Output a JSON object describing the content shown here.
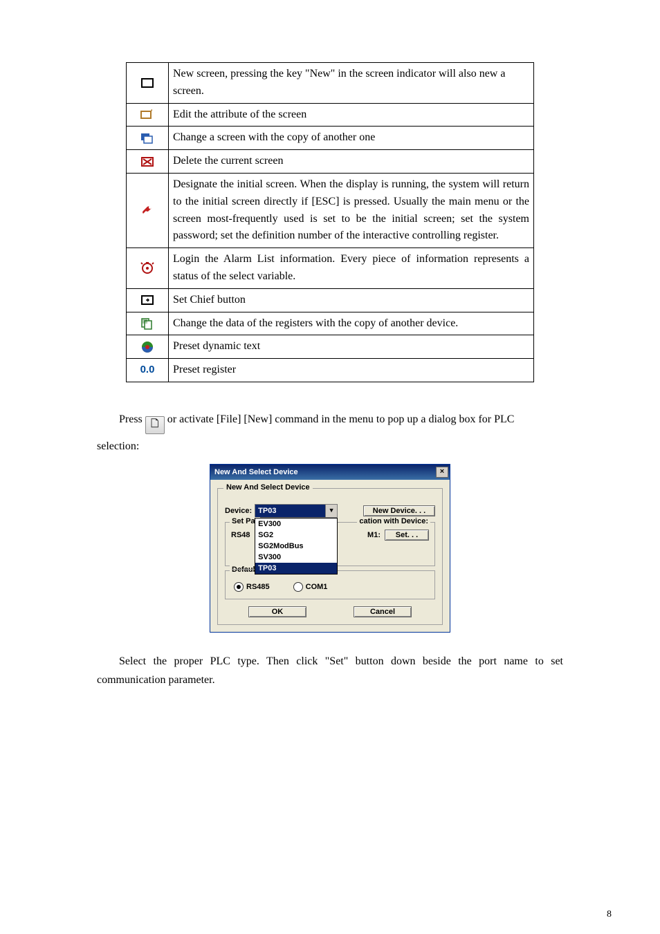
{
  "table": {
    "rows": [
      {
        "desc": "New screen, pressing the key \"New\" in the screen indicator will also new a screen."
      },
      {
        "desc": "Edit the attribute of the screen"
      },
      {
        "desc": "Change a screen with the copy of another one"
      },
      {
        "desc": "Delete the current screen"
      },
      {
        "desc": "Designate the initial screen. When the display is running, the system will return to the initial screen directly if [ESC] is pressed. Usually the main menu or the screen most-frequently used is set to be the initial screen; set the system password; set the definition number of the interactive controlling register."
      },
      {
        "desc": "Login the Alarm List information. Every piece of information represents a status of the select variable."
      },
      {
        "desc": "Set Chief button"
      },
      {
        "desc": "Change the data of the registers with the copy of another device."
      },
      {
        "desc": "Preset dynamic text"
      },
      {
        "desc": "Preset register",
        "prefix_text": "0.0"
      }
    ]
  },
  "para1_pre": "Press ",
  "para1_post": " or activate [File]   [New] command in the menu to pop up a dialog box for PLC",
  "para1_line2": "selection:",
  "dialog": {
    "title": "New And Select Device",
    "group_label": "New And Select Device",
    "device_label": "Device:",
    "device_value": "TP03",
    "new_device_btn": "New Device. . .",
    "options": [
      "EV300",
      "SG2",
      "SG2ModBus",
      "SV300",
      "TP03"
    ],
    "setpar_label1": "Set Par",
    "setpar_label2": "cation with Device:",
    "rs485_label": "RS48",
    "m1_label": "M1:",
    "set_btn": "Set. . .",
    "default_label": "Default option",
    "radio_rs485": "RS485",
    "radio_com1": "COM1",
    "ok": "OK",
    "cancel": "Cancel",
    "close_x": "×"
  },
  "para2": "Select the proper PLC type. Then click \"Set\" button down beside the port name to set communication parameter.",
  "pagenum": "8"
}
